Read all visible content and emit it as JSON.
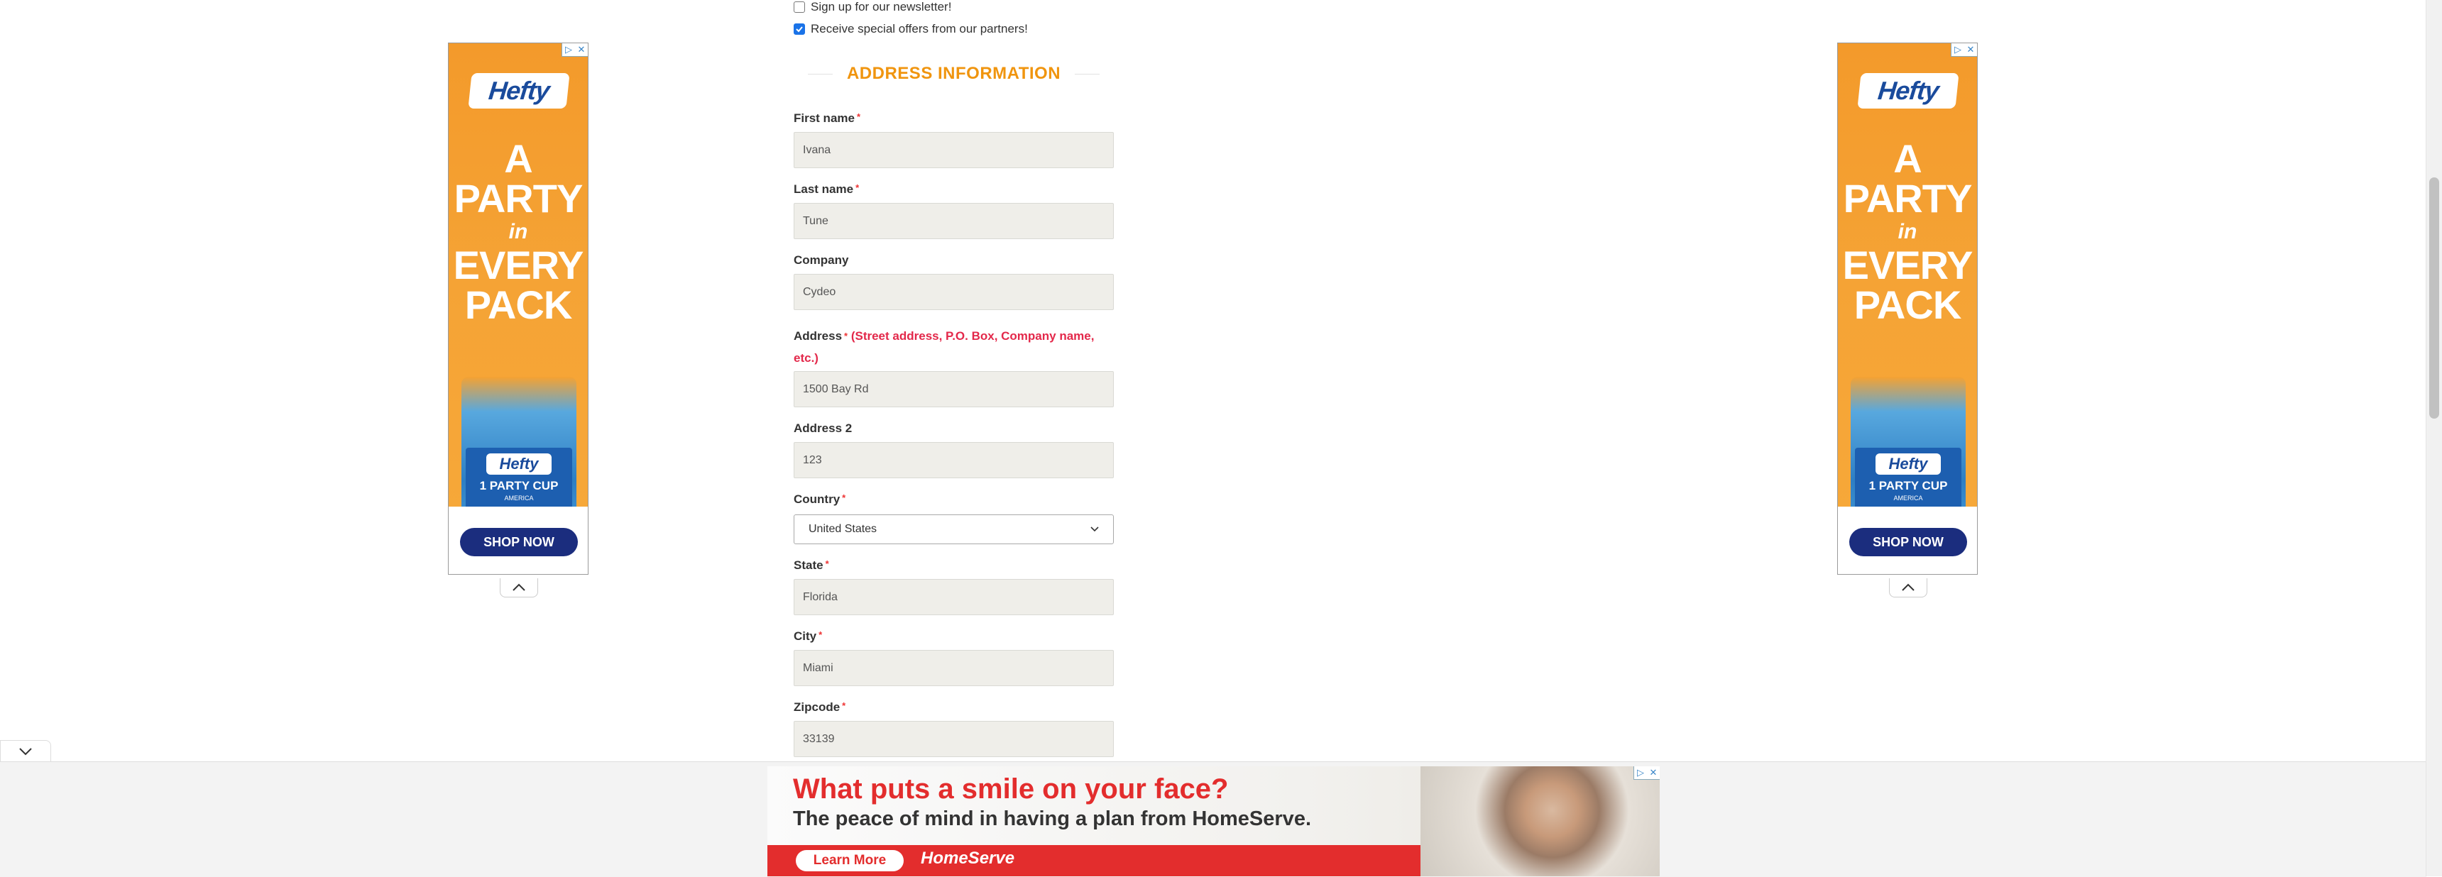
{
  "checkboxes": [
    {
      "label": "Sign up for our newsletter!",
      "checked": false
    },
    {
      "label": "Receive special offers from our partners!",
      "checked": true
    }
  ],
  "section_title": "ADDRESS INFORMATION",
  "fields": {
    "first_name": {
      "label": "First name",
      "value": "Ivana"
    },
    "last_name": {
      "label": "Last name",
      "value": "Tune"
    },
    "company": {
      "label": "Company",
      "value": "Cydeo"
    },
    "address": {
      "label": "Address",
      "hint": "(Street address, P.O. Box, Company name, etc.)",
      "value": "1500 Bay Rd"
    },
    "address2": {
      "label": "Address 2",
      "value": "123"
    },
    "country": {
      "label": "Country",
      "value": "United States"
    },
    "state": {
      "label": "State",
      "value": "Florida"
    },
    "city": {
      "label": "City",
      "value": "Miami"
    },
    "zipcode": {
      "label": "Zipcode",
      "value": "33139"
    }
  },
  "required_mark": "*",
  "side_ad": {
    "brand": "Hefty",
    "line1": "A",
    "line2": "PARTY",
    "line3": "in",
    "line4": "EVERY",
    "line5": "PACK",
    "cup_text": "1 PARTY CUP",
    "cup_sub": "AMERICA",
    "cta": "SHOP NOW"
  },
  "bottom_ad": {
    "headline": "What puts a smile on your face?",
    "subline": "The peace of mind in having a plan from HomeServe.",
    "cta": "Learn More",
    "brand": "HomeServe"
  },
  "colors": {
    "accent_orange": "#f0950f",
    "hint_red": "#e3284a",
    "ad_orange": "#f5a335",
    "homeserve_red": "#e32d2d"
  }
}
